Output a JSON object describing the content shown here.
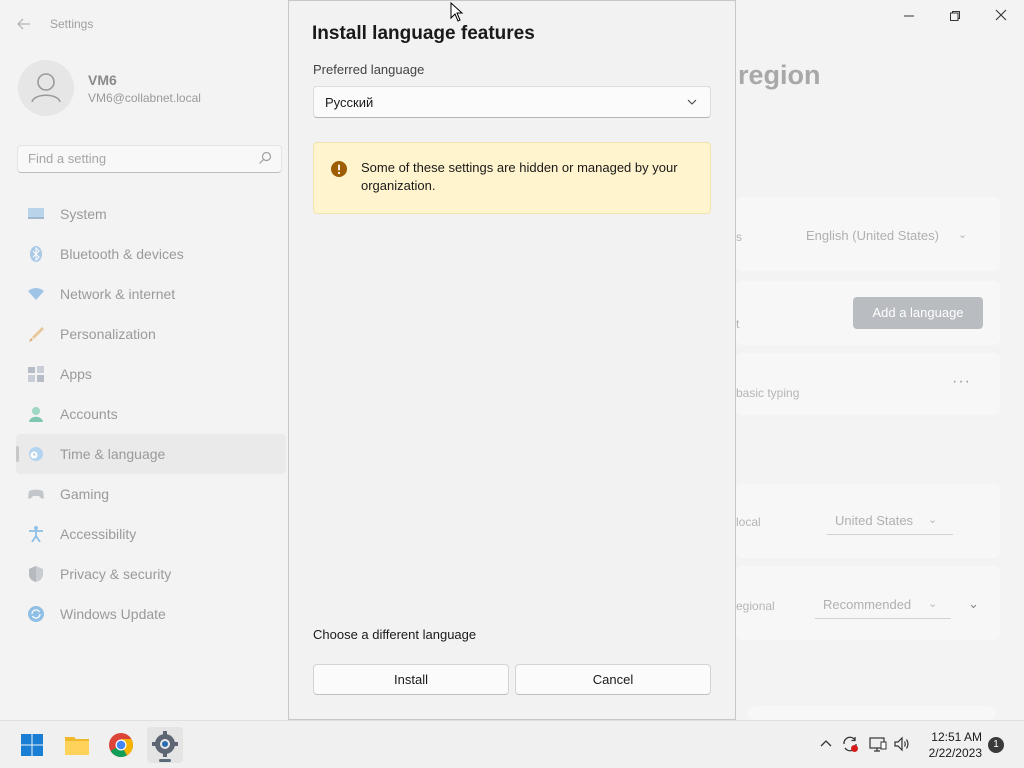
{
  "window": {
    "app_title": "Settings",
    "back_icon": "back-arrow-icon",
    "controls": [
      "minimize-icon",
      "maximize-icon",
      "close-icon"
    ]
  },
  "profile": {
    "name": "VM6",
    "email": "VM6@collabnet.local"
  },
  "search": {
    "placeholder": "Find a setting"
  },
  "sidebar": {
    "items": [
      {
        "label": "System",
        "icon": "system-icon"
      },
      {
        "label": "Bluetooth & devices",
        "icon": "bluetooth-icon"
      },
      {
        "label": "Network & internet",
        "icon": "network-icon"
      },
      {
        "label": "Personalization",
        "icon": "brush-icon"
      },
      {
        "label": "Apps",
        "icon": "apps-icon"
      },
      {
        "label": "Accounts",
        "icon": "accounts-icon"
      },
      {
        "label": "Time & language",
        "icon": "globe-clock-icon",
        "selected": true
      },
      {
        "label": "Gaming",
        "icon": "gamepad-icon"
      },
      {
        "label": "Accessibility",
        "icon": "accessibility-icon"
      },
      {
        "label": "Privacy & security",
        "icon": "shield-icon"
      },
      {
        "label": "Windows Update",
        "icon": "update-icon"
      }
    ]
  },
  "background": {
    "title_fragment": "region",
    "display_lang_label_frag": "s",
    "display_lang_value": "English (United States)",
    "preferred_frag": "t",
    "add_language": "Add a language",
    "lang_entry_frag": "basic typing",
    "country_frag": "local",
    "country_value": "United States",
    "format_frag": "egional",
    "format_value": "Recommended"
  },
  "dialog": {
    "title": "Install language features",
    "preferred_label": "Preferred language",
    "selected_language": "Русский",
    "notice_text": "Some of these settings are hidden or managed by your organization.",
    "different_language_link": "Choose a different language",
    "install_button": "Install",
    "cancel_button": "Cancel"
  },
  "taskbar": {
    "apps": [
      {
        "name": "start-icon"
      },
      {
        "name": "file-explorer-icon"
      },
      {
        "name": "chrome-icon"
      },
      {
        "name": "settings-app-icon",
        "active": true
      }
    ],
    "tray": [
      "chevron-up-icon",
      "sync-alert-icon",
      "network-monitor-icon",
      "volume-icon"
    ],
    "time": "12:51 AM",
    "date": "2/22/2023",
    "notifications": "1"
  },
  "colors": {
    "notice_bg": "#fff4ce",
    "notice_icon": "#9d5d00",
    "add_button_bg": "#b9bcc0"
  }
}
